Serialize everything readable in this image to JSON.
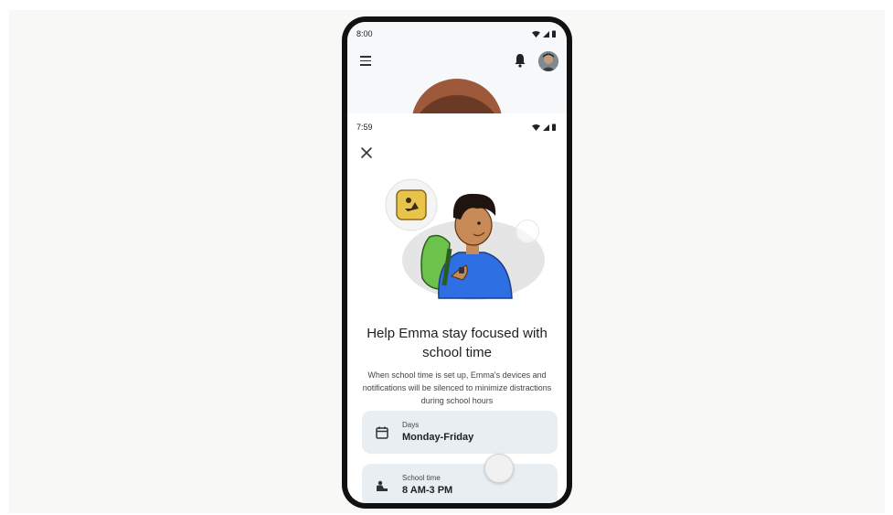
{
  "background_screen": {
    "status_time": "8:00"
  },
  "sheet": {
    "status_time": "7:59",
    "title": "Help Emma stay focused with school time",
    "description": "When school time is set up, Emma's devices and notifications will be silenced to minimize distractions during school hours",
    "cards": [
      {
        "label": "Days",
        "value": "Monday-Friday",
        "icon": "calendar-icon"
      },
      {
        "label": "School time",
        "value": "8 AM-3 PM",
        "icon": "school-icon"
      }
    ]
  },
  "colors": {
    "card_bg": "#e9eef3",
    "shirt_blue": "#2f6fe4",
    "backpack_green": "#6cc24a",
    "badge_yellow": "#e8c44a"
  }
}
